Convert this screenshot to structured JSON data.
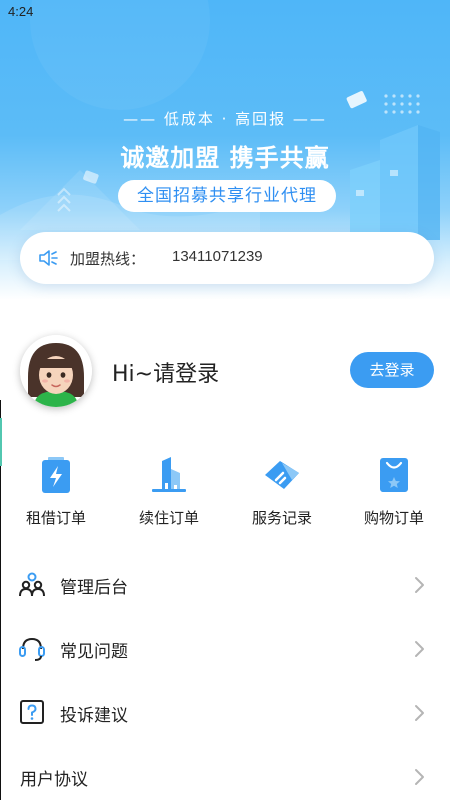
{
  "status_bar": {
    "time": "4:24"
  },
  "banner": {
    "subtitle": "—— 低成本 · 高回报 ——",
    "title": "诚邀加盟   携手共赢",
    "pill": "全国招募共享行业代理"
  },
  "hotline": {
    "label": "加盟热线：",
    "number": "13411071239",
    "icon": "speaker-icon"
  },
  "profile": {
    "greeting": "Hi~请登录",
    "login_button": "去登录"
  },
  "orders": [
    {
      "label": "租借订单",
      "icon": "battery-icon"
    },
    {
      "label": "续住订单",
      "icon": "building-icon"
    },
    {
      "label": "服务记录",
      "icon": "ticket-icon"
    },
    {
      "label": "购物订单",
      "icon": "shopping-bag-icon"
    }
  ],
  "menu": [
    {
      "label": "管理后台",
      "icon": "people-icon"
    },
    {
      "label": "常见问题",
      "icon": "headset-icon"
    },
    {
      "label": "投诉建议",
      "icon": "question-icon"
    },
    {
      "label": "用户协议",
      "icon": ""
    }
  ],
  "colors": {
    "primary": "#3b9cf2",
    "banner_top": "#4fb6f8",
    "pill_text": "#2f8ff2"
  }
}
